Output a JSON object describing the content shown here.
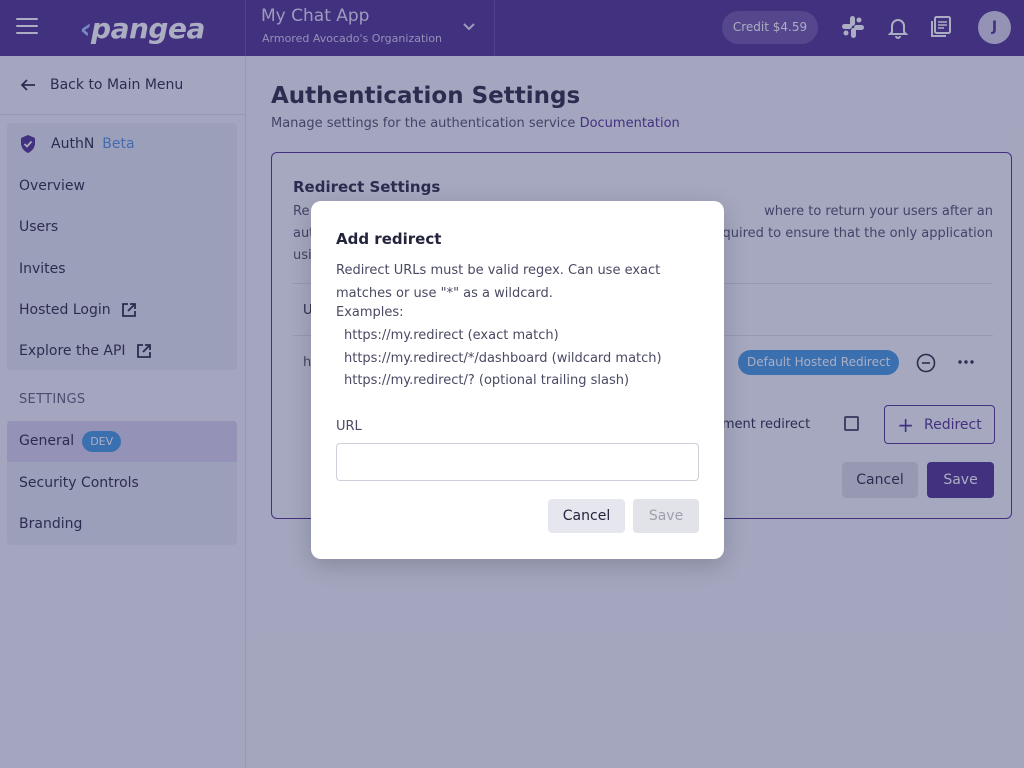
{
  "header": {
    "logo_text": "pangea",
    "project_name": "My Chat App",
    "organization": "Armored Avocado's Organization",
    "credit": "Credit $4.59",
    "avatar_initial": "J"
  },
  "sidebar": {
    "back_label": "Back to Main Menu",
    "service_name": "AuthN",
    "service_tag": "Beta",
    "items": [
      {
        "label": "Overview"
      },
      {
        "label": "Users"
      },
      {
        "label": "Invites"
      },
      {
        "label": "Hosted Login"
      },
      {
        "label": "Explore the API"
      }
    ],
    "settings_heading": "SETTINGS",
    "settings_items": [
      {
        "label": "General",
        "badge": "DEV"
      },
      {
        "label": "Security Controls"
      },
      {
        "label": "Branding"
      }
    ]
  },
  "main": {
    "title": "Authentication Settings",
    "subtitle": "Manage settings for the authentication service",
    "doc_link": "Documentation",
    "card": {
      "title": "Redirect Settings",
      "desc_left_1": "Re",
      "desc_right_1": "where to return your users after an",
      "desc_left_2": "aut",
      "desc_right_2": "quired to ensure that the only application",
      "desc_left_3": "usi",
      "col_header": "U",
      "row_url": "h",
      "default_badge": "Default Hosted Redirect",
      "dev_redirect_label": "lopment redirect",
      "add_redirect_label": "Redirect",
      "cancel_label": "Cancel",
      "save_label": "Save"
    }
  },
  "modal": {
    "title": "Add redirect",
    "description": "Redirect URLs must be valid regex. Can use exact matches or use \"*\" as a wildcard.",
    "examples_label": "Examples:",
    "examples": [
      "https://my.redirect (exact match)",
      "https://my.redirect/*/dashboard (wildcard match)",
      "https://my.redirect/? (optional trailing slash)"
    ],
    "url_label": "URL",
    "url_value": "",
    "cancel_label": "Cancel",
    "save_label": "Save"
  },
  "colors": {
    "brand": "#4a2a8c",
    "accent_blue": "#3f97e0"
  }
}
